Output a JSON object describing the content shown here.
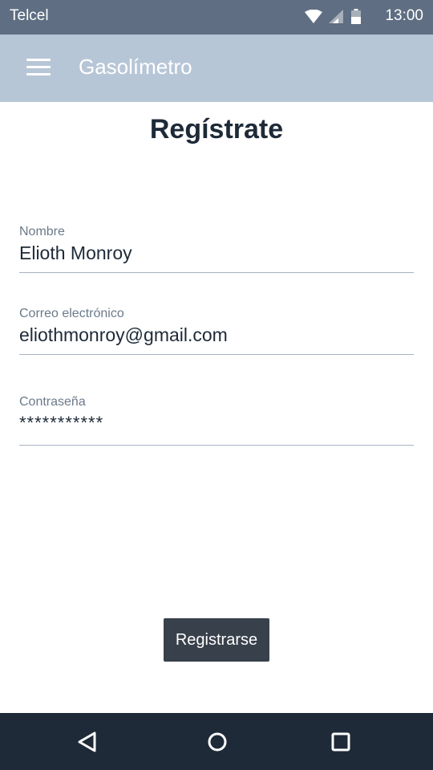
{
  "status_bar": {
    "carrier": "Telcel",
    "time": "13:00",
    "icons": [
      "wifi-icon",
      "signal-icon",
      "battery-icon"
    ]
  },
  "app_bar": {
    "title": "Gasolímetro",
    "menu_icon": "hamburger-menu-icon",
    "background_color": "#b7c6d6"
  },
  "form": {
    "title": "Regístrate",
    "fields": {
      "name": {
        "label": "Nombre",
        "value": "Elioth Monroy"
      },
      "email": {
        "label": "Correo electrónico",
        "value": "eliothmonroy@gmail.com"
      },
      "password": {
        "label": "Contraseña",
        "value": "***********"
      }
    },
    "submit_label": "Registrarse"
  },
  "nav_bar": {
    "buttons": [
      "back-icon",
      "home-icon",
      "recents-icon"
    ]
  },
  "colors": {
    "status_bar": "#5f6e82",
    "button": "#38414b",
    "nav_bar": "#1e2a38",
    "text_dark": "#1e2a38"
  }
}
